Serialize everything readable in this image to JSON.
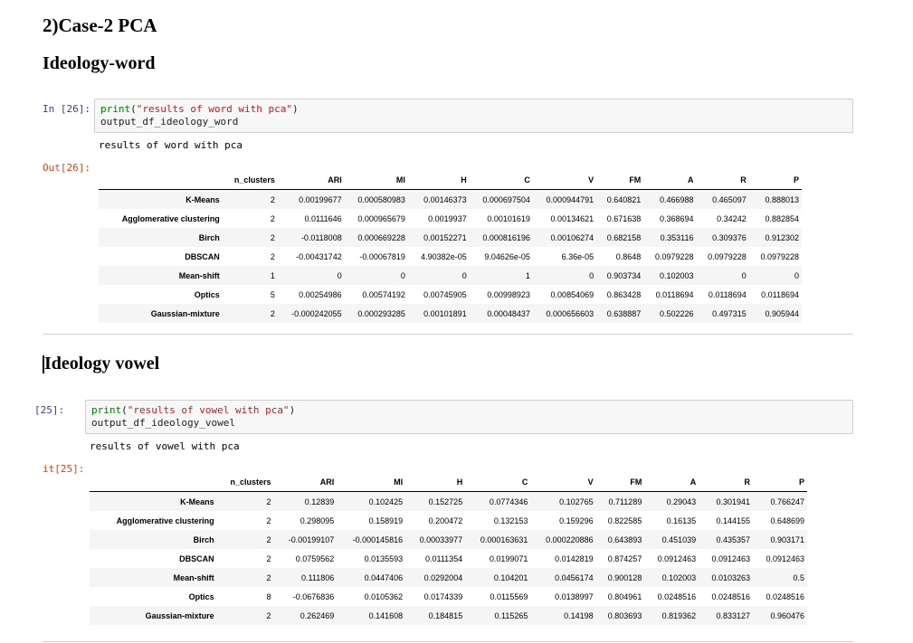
{
  "heading_case": "2)Case-2 PCA",
  "section1": {
    "title": "Ideology-word",
    "in_prompt": "In [26]:",
    "code_fn": "print",
    "code_str": "\"results of word with pca\"",
    "code_line2": "output_df_ideology_word",
    "stdout": "results of word with pca",
    "out_prompt": "Out[26]:",
    "table": {
      "columns": [
        "n_clusters",
        "ARI",
        "MI",
        "H",
        "C",
        "V",
        "FM",
        "A",
        "R",
        "P"
      ],
      "rows": [
        {
          "label": "K-Means",
          "cells": [
            "2",
            "0.00199677",
            "0.000580983",
            "0.00146373",
            "0.000697504",
            "0.000944791",
            "0.640821",
            "0.466988",
            "0.465097",
            "0.888013"
          ]
        },
        {
          "label": "Agglomerative clustering",
          "cells": [
            "2",
            "0.0111646",
            "0.000965679",
            "0.0019937",
            "0.00101619",
            "0.00134621",
            "0.671638",
            "0.368694",
            "0.34242",
            "0.882854"
          ]
        },
        {
          "label": "Birch",
          "cells": [
            "2",
            "-0.0118008",
            "0.000669228",
            "0.00152271",
            "0.000816196",
            "0.00106274",
            "0.682158",
            "0.353116",
            "0.309376",
            "0.912302"
          ]
        },
        {
          "label": "DBSCAN",
          "cells": [
            "2",
            "-0.00431742",
            "-0.00067819",
            "4.90382e-05",
            "9.04626e-05",
            "6.36e-05",
            "0.8648",
            "0.0979228",
            "0.0979228",
            "0.0979228"
          ]
        },
        {
          "label": "Mean-shift",
          "cells": [
            "1",
            "0",
            "0",
            "0",
            "1",
            "0",
            "0.903734",
            "0.102003",
            "0",
            "0"
          ]
        },
        {
          "label": "Optics",
          "cells": [
            "5",
            "0.00254986",
            "0.00574192",
            "0.00745905",
            "0.00998923",
            "0.00854069",
            "0.863428",
            "0.0118694",
            "0.0118694",
            "0.0118694"
          ]
        },
        {
          "label": "Gaussian-mixture",
          "cells": [
            "2",
            "-0.000242055",
            "0.000293285",
            "0.00101891",
            "0.00048437",
            "0.000656603",
            "0.638887",
            "0.502226",
            "0.497315",
            "0.905944"
          ]
        }
      ]
    }
  },
  "section2": {
    "title": "Ideology vowel",
    "in_prompt": "[25]:",
    "code_fn": "print",
    "code_str": "\"results of vowel with pca\"",
    "code_line2": "output_df_ideology_vowel",
    "stdout": "results of vowel with pca",
    "out_prompt": "it[25]:",
    "table": {
      "columns": [
        "n_clusters",
        "ARI",
        "MI",
        "H",
        "C",
        "V",
        "FM",
        "A",
        "R",
        "P"
      ],
      "rows": [
        {
          "label": "K-Means",
          "cells": [
            "2",
            "0.12839",
            "0.102425",
            "0.152725",
            "0.0774346",
            "0.102765",
            "0.711289",
            "0.29043",
            "0.301941",
            "0.766247"
          ]
        },
        {
          "label": "Agglomerative clustering",
          "cells": [
            "2",
            "0.298095",
            "0.158919",
            "0.200472",
            "0.132153",
            "0.159296",
            "0.822585",
            "0.16135",
            "0.144155",
            "0.648699"
          ]
        },
        {
          "label": "Birch",
          "cells": [
            "2",
            "-0.00199107",
            "-0.000145816",
            "0.00033977",
            "0.000163631",
            "0.000220886",
            "0.643893",
            "0.451039",
            "0.435357",
            "0.903171"
          ]
        },
        {
          "label": "DBSCAN",
          "cells": [
            "2",
            "0.0759562",
            "0.0135593",
            "0.0111354",
            "0.0199071",
            "0.0142819",
            "0.874257",
            "0.0912463",
            "0.0912463",
            "0.0912463"
          ]
        },
        {
          "label": "Mean-shift",
          "cells": [
            "2",
            "0.111806",
            "0.0447406",
            "0.0292004",
            "0.104201",
            "0.0456174",
            "0.900128",
            "0.102003",
            "0.0103263",
            "0.5"
          ]
        },
        {
          "label": "Optics",
          "cells": [
            "8",
            "-0.0676836",
            "0.0105362",
            "0.0174339",
            "0.0115569",
            "0.0138997",
            "0.804961",
            "0.0248516",
            "0.0248516",
            "0.0248516"
          ]
        },
        {
          "label": "Gaussian-mixture",
          "cells": [
            "2",
            "0.262469",
            "0.141608",
            "0.184815",
            "0.115265",
            "0.14198",
            "0.803693",
            "0.819362",
            "0.833127",
            "0.960476"
          ]
        }
      ]
    }
  }
}
